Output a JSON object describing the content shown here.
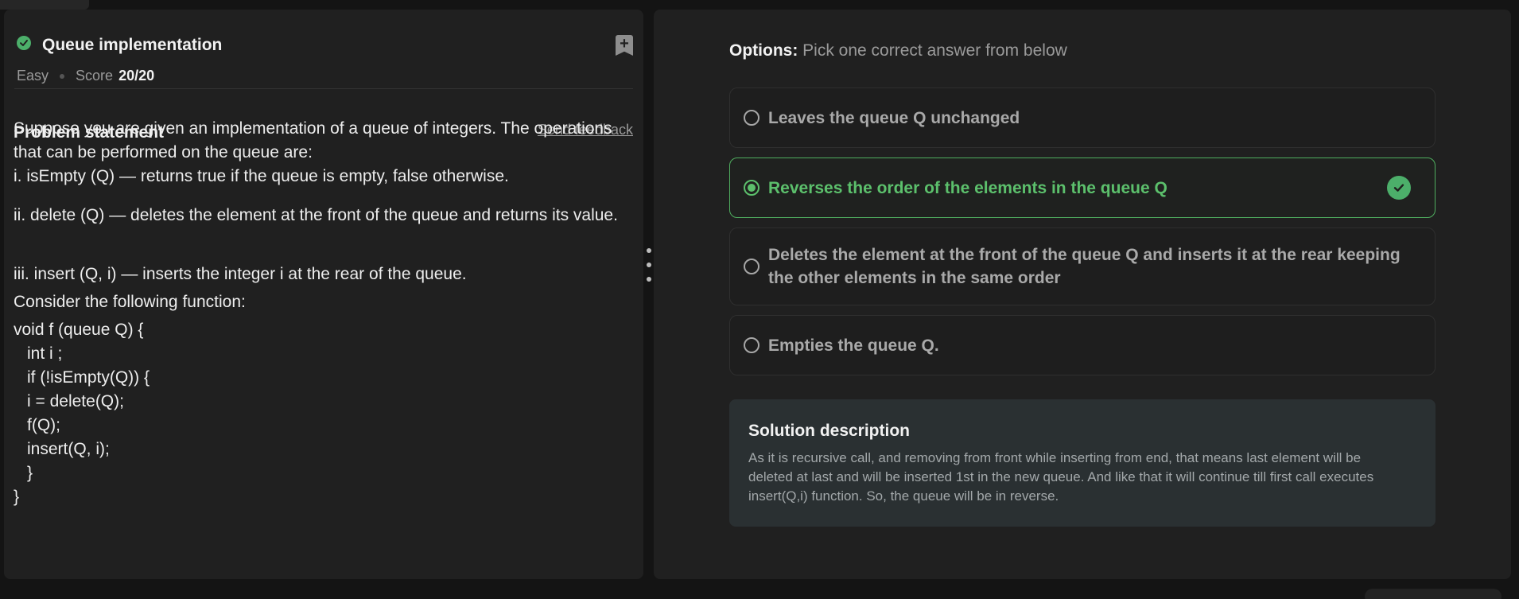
{
  "problem": {
    "title": "Queue implementation",
    "difficulty": "Easy",
    "score_label": "Score",
    "score_value": "20/20",
    "statement_heading": "Problem statement",
    "feedback_link": "Send feedback",
    "intro": "Suppose you are given an implementation of a queue of integers. The operations that can be performed on the queue are:",
    "ops": [
      "i. isEmpty (Q) — returns true if the queue is empty, false otherwise.",
      "ii. delete (Q) — deletes the element at the front of the queue and returns its value.",
      "iii. insert (Q, i) — inserts the integer i at the rear of the queue."
    ],
    "consider": "Consider the following function:",
    "code": [
      "void f (queue Q) {",
      "int i ;",
      "if (!isEmpty(Q)) {",
      "i = delete(Q);",
      "f(Q);",
      "insert(Q, i);",
      "}",
      "}"
    ]
  },
  "options": {
    "label_bold": "Options:",
    "label_rest": "Pick one correct answer from below",
    "items": [
      {
        "text": "Leaves the queue Q unchanged",
        "selected": false
      },
      {
        "text": "Reverses the order of the elements in the queue Q",
        "selected": true
      },
      {
        "text": "Deletes the element at the front of the queue Q and inserts it at the rear keeping the other elements in the same order",
        "selected": false
      },
      {
        "text": "Empties the queue Q.",
        "selected": false
      }
    ]
  },
  "solution": {
    "title": "Solution description",
    "text": "As it is recursive call, and removing from front while inserting from end, that means last element will be deleted at last and will be inserted 1st in the new queue. And like that it will continue till first call executes insert(Q,i) function. So, the queue will be in reverse."
  },
  "colors": {
    "accent_green": "#5cc06c",
    "panel_bg": "#202020",
    "page_bg": "#141414",
    "solution_bg": "#2a3032"
  },
  "icons": [
    "check-circle-icon",
    "bookmark-add-icon",
    "radio-icon",
    "drag-handle-icon"
  ]
}
